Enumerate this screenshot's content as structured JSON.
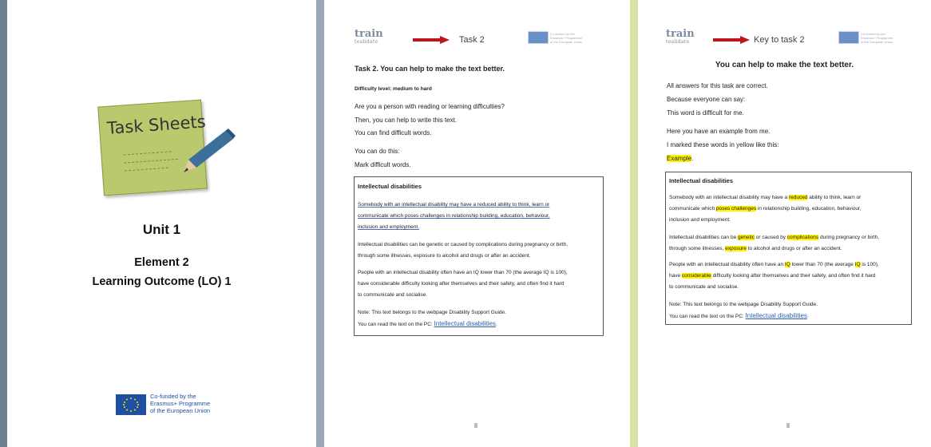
{
  "cover": {
    "sticky_title": "Task Sheets",
    "unit": "Unit 1",
    "element": "Element 2",
    "lo": "Learning Outcome (LO) 1",
    "eu_lines": [
      "Co-funded by the",
      "Erasmus+ Programme",
      "of the European Union"
    ]
  },
  "header": {
    "logo_main": "train",
    "logo_sub": "tealidate",
    "eu_lines": [
      "Co-funded by the",
      "Erasmus+ Programme",
      "of the European Union"
    ]
  },
  "task": {
    "label": "Task 2",
    "title": "Task 2. You can help to make the text better.",
    "difficulty": "Difficulty level: medium to hard",
    "intro": [
      "Are you a person with reading or learning difficulties?",
      "Then, you can help to write this text.",
      "You can find difficult words."
    ],
    "do_lines": [
      "You can do this:",
      "Mark difficult words."
    ],
    "box": {
      "heading": "Intellectual disabilities",
      "p1": [
        "Somebody with an intellectual disability may have a reduced ability to think, learn or",
        "communicate which poses challenges in relationship building, education, behaviour,",
        "inclusion and employment."
      ],
      "p2": [
        "Intellectual disabilities can be genetic or caused by complications during pregnancy or birth,",
        "through some illnesses, exposure to alcohol and drugs or after an accident."
      ],
      "p3": [
        "People with an intellectual disability often have an IQ lower than 70 (the average IQ is 100),",
        "have considerable difficulty looking after themselves and their safety, and often find it hard",
        "to communicate and socialise."
      ],
      "note": "Note: This text belongs to the webpage Disability Support Guide.",
      "read_prefix": "You can read the text on the PC: ",
      "link": "Intellectual disabilities",
      "link_end": "."
    }
  },
  "key": {
    "label": "Key to task 2",
    "title": "You can help to make the text better.",
    "intro": [
      "All answers for this task are correct.",
      "Because everyone can say:",
      "This word is difficult for me."
    ],
    "example_lines": [
      "Here you have an example from me.",
      "I marked these words in yellow like this:"
    ],
    "example_word": "Example",
    "example_end": ".",
    "box": {
      "heading": "Intellectual disabilities",
      "p1a": "Somebody with an intellectual disability may have a ",
      "p1b": "reduced",
      "p1c": " ability to think, learn or",
      "p1d": "communicate which ",
      "p1e": "poses challenges",
      "p1f": " in relationship building, education, behaviour,",
      "p1g": "inclusion and employment.",
      "p2a": "Intellectual disabilities can be ",
      "p2b": "genetic",
      "p2c": " or caused by ",
      "p2d": "complications",
      "p2e": " during pregnancy or birth,",
      "p2f": "through some illnesses, ",
      "p2g": "exposure",
      "p2h": " to alcohol and drugs or after an accident.",
      "p3a": "People with an intellectual disability often have an ",
      "p3b": "IQ",
      "p3c": " lower than 70 (the average ",
      "p3d": "IQ",
      "p3e": " is 100),",
      "p3f": "have ",
      "p3g": "considerable",
      "p3h": " difficulty looking after themselves and their safety, and often find it hard",
      "p3i": "to communicate and socialise.",
      "note": "Note: This text belongs to the webpage Disability Support Guide.",
      "read_prefix": "You can read the text on the PC: ",
      "link": "Intellectual disabilities",
      "link_end": "."
    }
  },
  "colors": {
    "accent_red": "#c0141c",
    "highlight": "#fff200",
    "sticky_green": "#b9c96e",
    "eu_blue": "#1f4fa3"
  }
}
